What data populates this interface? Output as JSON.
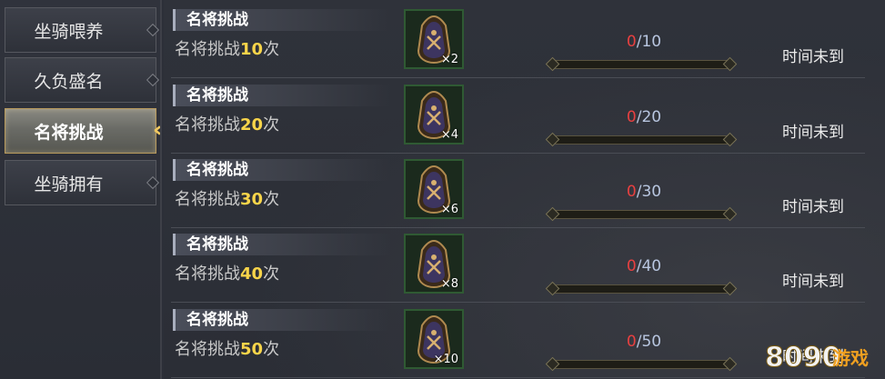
{
  "sidebar": {
    "items": [
      {
        "label": "坐骑喂养"
      },
      {
        "label": "久负盛名"
      },
      {
        "label": "名将挑战"
      },
      {
        "label": "坐骑拥有"
      }
    ]
  },
  "tasks": [
    {
      "title": "名将挑战",
      "desc_prefix": "名将挑战",
      "desc_num": "10",
      "desc_suffix": "次",
      "reward_count": "×2",
      "progress_current": "0",
      "progress_sep": "/",
      "progress_total": "10",
      "progress": 0,
      "status": "时间未到"
    },
    {
      "title": "名将挑战",
      "desc_prefix": "名将挑战",
      "desc_num": "20",
      "desc_suffix": "次",
      "reward_count": "×4",
      "progress_current": "0",
      "progress_sep": "/",
      "progress_total": "20",
      "progress": 0,
      "status": "时间未到"
    },
    {
      "title": "名将挑战",
      "desc_prefix": "名将挑战",
      "desc_num": "30",
      "desc_suffix": "次",
      "reward_count": "×6",
      "progress_current": "0",
      "progress_sep": "/",
      "progress_total": "30",
      "progress": 0,
      "status": "时间未到"
    },
    {
      "title": "名将挑战",
      "desc_prefix": "名将挑战",
      "desc_num": "40",
      "desc_suffix": "次",
      "reward_count": "×8",
      "progress_current": "0",
      "progress_sep": "/",
      "progress_total": "40",
      "progress": 0,
      "status": "时间未到"
    },
    {
      "title": "名将挑战",
      "desc_prefix": "名将挑战",
      "desc_num": "50",
      "desc_suffix": "次",
      "reward_count": "×10",
      "progress_current": "0",
      "progress_sep": "/",
      "progress_total": "50",
      "progress": 0,
      "status": "时间未到"
    }
  ],
  "watermark": {
    "text": "8090游戏"
  },
  "colors": {
    "accent_gold": "#f7d44a",
    "progress_current": "#e84040",
    "active_tab_border": "#b89a5c"
  }
}
